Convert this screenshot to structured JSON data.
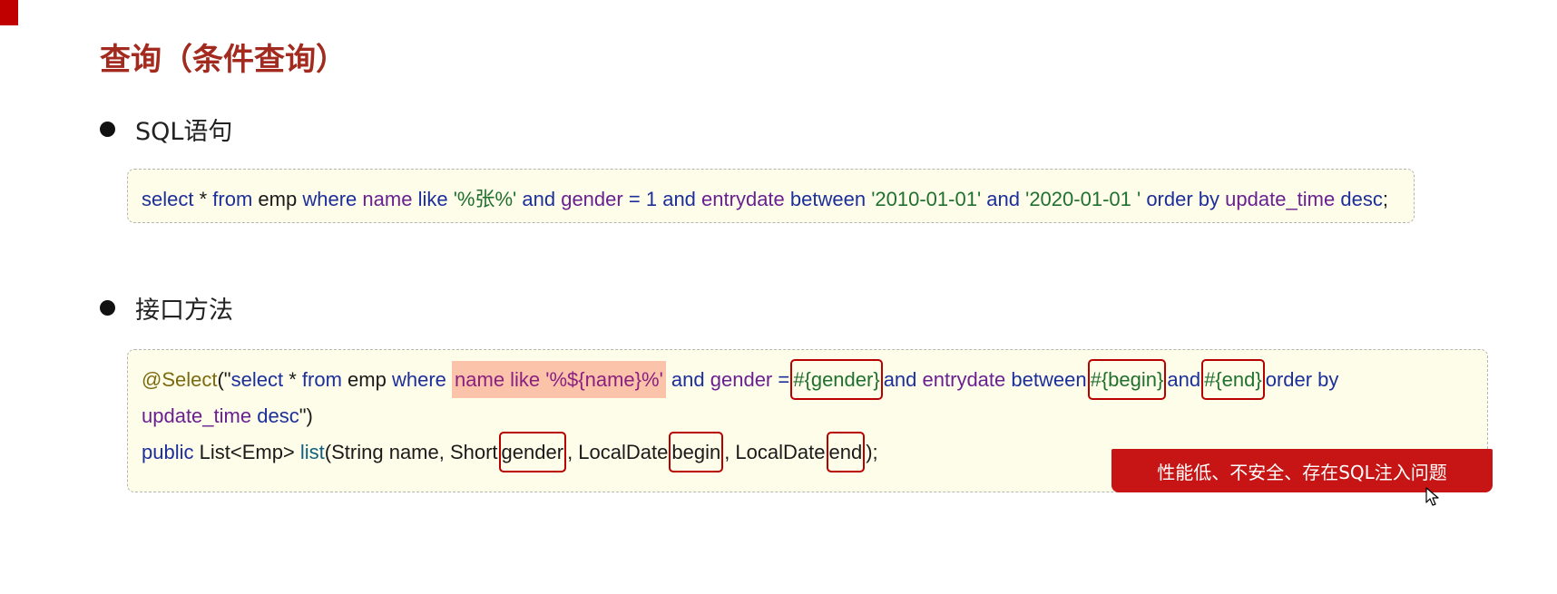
{
  "title": "查询（条件查询）",
  "sections": {
    "sql": {
      "heading": "SQL语句"
    },
    "interface": {
      "heading": "接口方法"
    }
  },
  "sql_code": {
    "t1": "select",
    "t2": "* ",
    "t3": "from",
    "t4": "emp",
    "t5": "where",
    "t6": "name",
    "t7": "like",
    "t8": "'%张%'",
    "t9": "and",
    "t10": "gender",
    "t11": "=",
    "t12": "1",
    "t13": "and",
    "t14": "entrydate",
    "t15": "between",
    "t16": "'2010-01-01'",
    "t17": "and",
    "t18": "'2020-01-01 '",
    "t19": "order by",
    "t20": "update_time",
    "t21": "desc",
    "t22": ";"
  },
  "method_code": {
    "l1a": "@Select",
    "l1b": "(\"",
    "l1c": "select",
    "l1d": "*",
    "l1e": "from",
    "l1f": "emp",
    "l1g": "where",
    "l1h": "name like '%${name}%'",
    "l1i": "and",
    "l1j": "gender",
    "l1k": "=",
    "l1l": "#{gender}",
    "l1m": "and",
    "l1n": "entrydate",
    "l1o": "between",
    "l1p": "#{begin}",
    "l1q": "and",
    "l1r": "#{end}",
    "l1s": "order by",
    "l2a": "update_time",
    "l2b": "desc",
    "l2c": "\")",
    "l3a": "public",
    "l3b": "List<Emp>",
    "l3c": "list",
    "l3d": "(String name, Short",
    "l3e": "gender",
    "l3f": ", LocalDate",
    "l3g": "begin",
    "l3h": ", LocalDate",
    "l3i": "end",
    "l3j": ");"
  },
  "warning": "性能低、不安全、存在SQL注入问题",
  "colors": {
    "title": "#a32a1e",
    "keyword": "#1c2f9a",
    "column": "#6a2090",
    "string": "#207030",
    "highlight": "#fbc4aa",
    "box_border": "#b70000",
    "banner": "#c71414",
    "code_bg": "#fefde9"
  },
  "icons": {
    "cursor": "mouse-pointer-icon"
  }
}
